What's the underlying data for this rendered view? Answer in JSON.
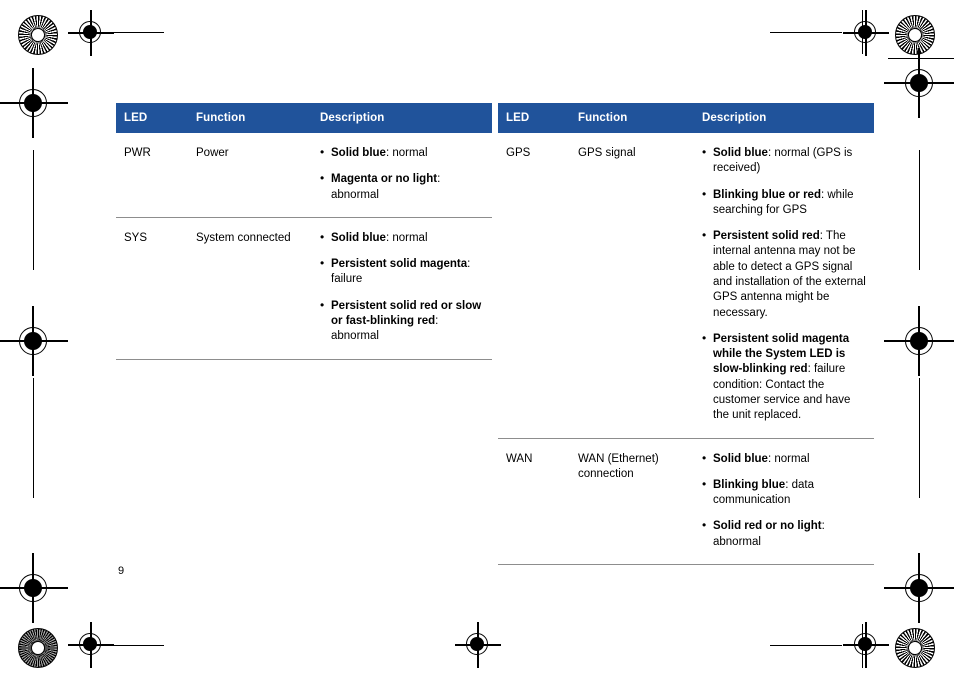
{
  "document": {
    "page_number": "9",
    "accent_color": "#20539b",
    "rule_color": "#8d8d8d"
  },
  "tables": [
    {
      "id": "left-table",
      "headers": {
        "led": "LED",
        "function": "Function",
        "description": "Description"
      },
      "rows": [
        {
          "led": "PWR",
          "function": "Power",
          "items": [
            {
              "bold": "Solid blue",
              "rest": ": normal"
            },
            {
              "bold": "Magenta or no light",
              "rest": ": abnormal"
            }
          ]
        },
        {
          "led": "SYS",
          "function": "System connected",
          "items": [
            {
              "bold": "Solid blue",
              "rest": ": normal"
            },
            {
              "bold": "Persistent solid magenta",
              "rest": ": failure"
            },
            {
              "bold": "Persistent solid red or slow or fast-blinking red",
              "rest": ": abnormal"
            }
          ]
        }
      ]
    },
    {
      "id": "right-table",
      "headers": {
        "led": "LED",
        "function": "Function",
        "description": "Description"
      },
      "rows": [
        {
          "led": "GPS",
          "function": "GPS signal",
          "items": [
            {
              "bold": "Solid blue",
              "rest": ": normal (GPS is received)"
            },
            {
              "bold": "Blinking blue or red",
              "rest": ": while searching for GPS"
            },
            {
              "bold": "Persistent solid red",
              "rest": ": The internal antenna may not be able to detect a GPS signal and installation of the external GPS antenna might be necessary."
            },
            {
              "bold": "Persistent solid magenta while the System LED is slow-blinking red",
              "rest": ": failure condition: Contact the customer service and have the unit replaced."
            }
          ]
        },
        {
          "led": "WAN",
          "function": "WAN (Ethernet) connection",
          "items": [
            {
              "bold": "Solid blue",
              "rest": ": normal"
            },
            {
              "bold": "Blinking blue",
              "rest": ": data communication"
            },
            {
              "bold": "Solid red or no light",
              "rest": ": abnormal"
            }
          ]
        }
      ]
    }
  ]
}
